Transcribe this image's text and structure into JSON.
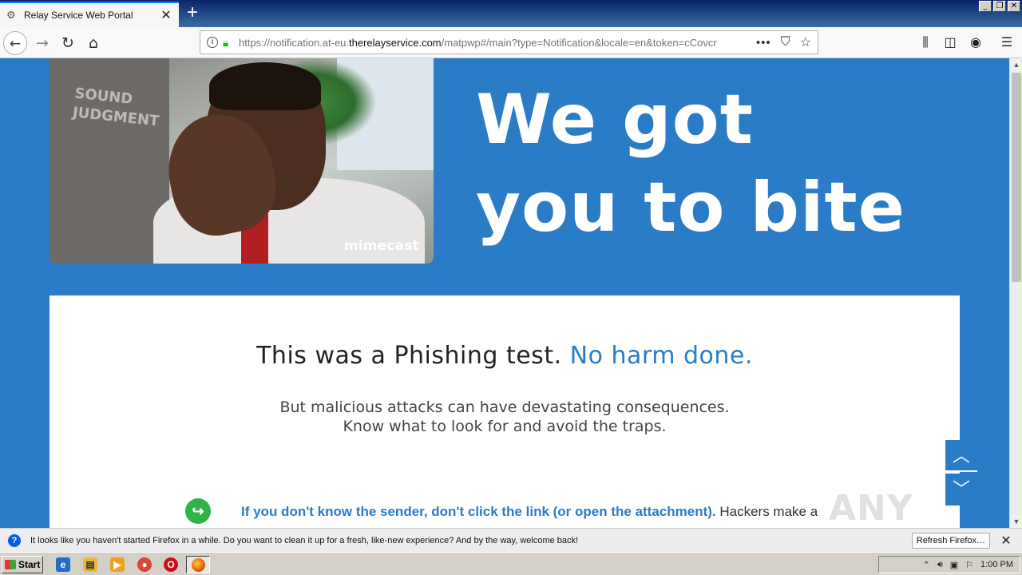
{
  "browser": {
    "tab_title": "Relay Service Web Portal",
    "new_tab_label": "+",
    "url_prefix": "https://notification.at-eu.",
    "url_domain": "therelayservice.com",
    "url_suffix": "/matpwp#/main?type=Notification&locale=en&token=cCovcr",
    "page_actions_label": "•••"
  },
  "hero": {
    "title_line1": "We got",
    "title_line2": "you to bite",
    "photo_shirt_text": "SOUND\nJUDGMENT",
    "photo_logo": "mimecast"
  },
  "card": {
    "heading_plain": "This was a Phishing test.",
    "heading_accent": "No harm done.",
    "sub_line1": "But malicious attacks can have devastating consequences.",
    "sub_line2": "Know what to look for and avoid the traps.",
    "tip_bold": "If you don't know the sender, don't click the link (or open the attachment).",
    "tip_rest": " Hackers make a"
  },
  "watermark": "ANY RUN",
  "notification": {
    "message": "It looks like you haven't started Firefox in a while. Do you want to clean it up for a fresh, like-new experience? And by the way, welcome back!",
    "refresh_button": "Refresh Firefox…"
  },
  "taskbar": {
    "start_label": "Start",
    "clock": "1:00 PM"
  },
  "colors": {
    "page_blue": "#2a7cc7",
    "accent_green": "#2fb34a",
    "secure_lock": "#12bc00"
  },
  "icons": [
    "info-icon",
    "lock-icon",
    "pocket-icon",
    "star-icon",
    "library-icon",
    "sidebar-icon",
    "account-icon",
    "menu-icon",
    "share-arrow-icon",
    "chevron-up-icon",
    "chevron-down-icon"
  ]
}
